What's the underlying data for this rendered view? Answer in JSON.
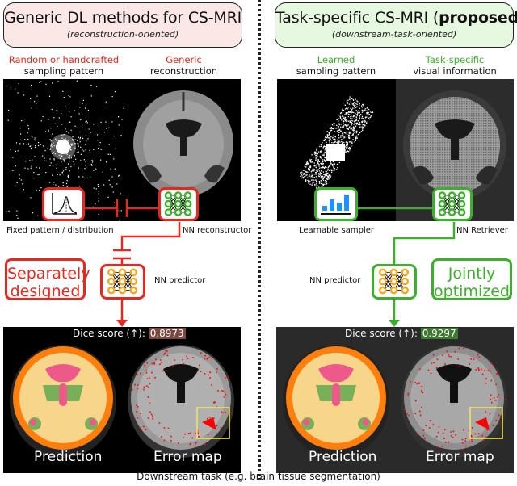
{
  "left": {
    "title": "Generic DL methods for CS-MRI",
    "subtitle": "(reconstruction-oriented)",
    "col1_highlight": "Random or handcrafted",
    "col1_label": "sampling pattern",
    "col2_highlight": "Generic",
    "col2_label": "reconstruction",
    "sampler_caption": "Fixed pattern / distribution",
    "reconstructor_caption": "NN reconstructor",
    "predictor_caption": "NN predictor",
    "note": [
      "Separately",
      "designed"
    ],
    "dice_label": "Dice score (↑): ",
    "dice_value": "0.8973",
    "prediction_label": "Prediction",
    "errormap_label": "Error map",
    "accent": "#e8281e"
  },
  "right": {
    "title_main": "Task-specific CS-MRI (",
    "title_bold": "proposed",
    "title_end": ")",
    "subtitle": "(downstream-task-oriented)",
    "col1_highlight": "Learned",
    "col1_label": "sampling pattern",
    "col2_highlight": "Task-specific",
    "col2_label": "visual information",
    "sampler_caption": "Learnable sampler",
    "retriever_caption": "NN Retriever",
    "predictor_caption": "NN predictor",
    "note": [
      "Jointly",
      "optimized"
    ],
    "dice_label": "Dice score (↑): ",
    "dice_value": "0.9297",
    "prediction_label": "Prediction",
    "errormap_label": "Error map",
    "accent": "#3bb02a"
  },
  "icons": {
    "fixed_distribution": "gaussian-curve-icon",
    "learnable_sampler": "bar-chart-icon",
    "neural_network": "neural-network-icon"
  },
  "footer": "Downstream task (e.g. brain tissue segmentation)"
}
